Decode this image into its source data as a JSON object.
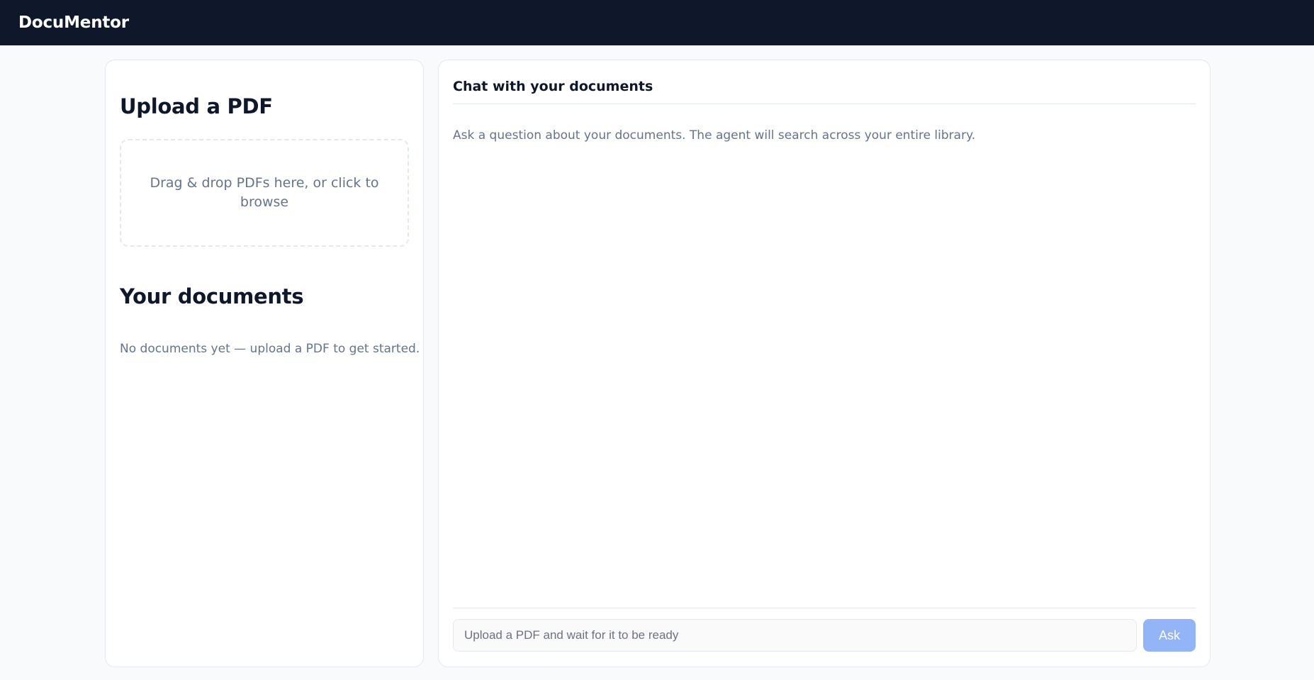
{
  "app": {
    "title": "DocuMentor"
  },
  "sidebar": {
    "upload": {
      "title": "Upload a PDF",
      "dropzone_text": "Drag & drop PDFs here, or click to browse"
    },
    "documents": {
      "title": "Your documents",
      "empty_text": "No documents yet — upload a PDF to get started."
    }
  },
  "chat": {
    "title": "Chat with your documents",
    "hint": "Ask a question about your documents. The agent will search across your entire library.",
    "input": {
      "value": "",
      "placeholder": "Upload a PDF and wait for it to be ready"
    },
    "ask_label": "Ask"
  },
  "colors": {
    "topbar": "#0f172a",
    "background": "#f8fafc",
    "muted_text": "#64748b",
    "border": "#e2e8f0",
    "ask_disabled": "#93b4f7"
  }
}
